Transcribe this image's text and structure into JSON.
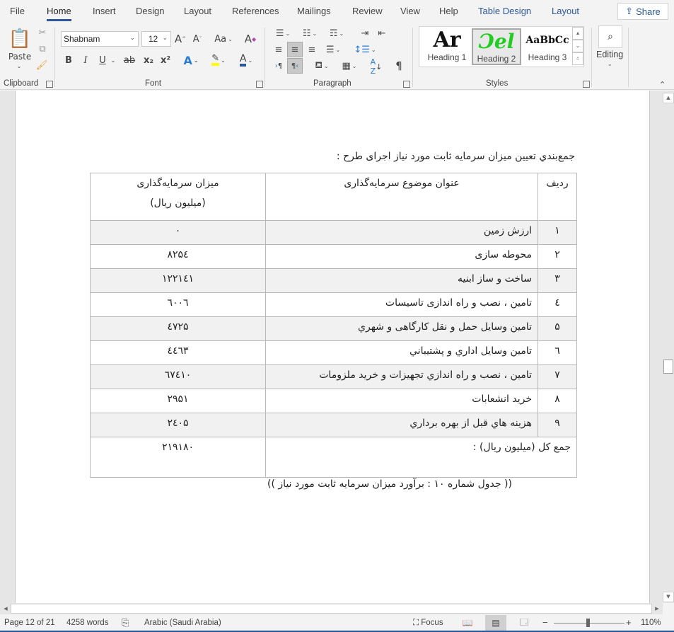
{
  "tabs": [
    {
      "label": "File"
    },
    {
      "label": "Home",
      "active": true
    },
    {
      "label": "Insert"
    },
    {
      "label": "Design"
    },
    {
      "label": "Layout"
    },
    {
      "label": "References"
    },
    {
      "label": "Mailings"
    },
    {
      "label": "Review"
    },
    {
      "label": "View"
    },
    {
      "label": "Help"
    },
    {
      "label": "Table Design",
      "contextual": true
    },
    {
      "label": "Layout",
      "contextual": true
    }
  ],
  "share_label": "Share",
  "ribbon": {
    "clipboard": {
      "label": "Clipboard",
      "paste_label": "Paste"
    },
    "font": {
      "label": "Font",
      "font_name": "Shabnam",
      "font_size": "12",
      "change_case": "Aa",
      "bold": "B",
      "italic": "I",
      "underline": "U",
      "strike": "ab",
      "subscript": "x₂",
      "superscript": "x²"
    },
    "paragraph": {
      "label": "Paragraph"
    },
    "styles": {
      "label": "Styles",
      "items": [
        {
          "preview": "Ar",
          "name": "Heading 1"
        },
        {
          "preview": "Ɔel",
          "name": "Heading 2",
          "selected": true
        },
        {
          "preview": "AaBbCc",
          "name": "Heading 3"
        }
      ]
    },
    "editing": {
      "label": "Editing"
    }
  },
  "colors": {
    "accent": "#2b579a",
    "highlight": "#ffff00",
    "font_color": "#2b579a",
    "heading2_preview": "#22cc22",
    "row_shade": "#f1f1f1"
  },
  "document": {
    "heading": "جمع‌بندي تعيين ميزان سرمايه ثابت مورد نياز اجراى طرح :",
    "table": {
      "headers": {
        "num": "رديف",
        "title": "عنوان موضوع سرمایه‌گذاری",
        "value": "ميزان سرمایه‌گذاری",
        "value_unit": "(ميليون ريال)"
      },
      "rows": [
        {
          "num": "۱",
          "title": "ارزش زمين",
          "value": "۰"
        },
        {
          "num": "۲",
          "title": "محوطه سازی",
          "value": "۸۲۵٤"
        },
        {
          "num": "۳",
          "title": "ساخت و ساز ابنيه",
          "value": "۱۲۲۱٤۱"
        },
        {
          "num": "٤",
          "title": "تامين ، نصب و راه اندازی تاسيسات",
          "value": "٦۰۰٦"
        },
        {
          "num": "۵",
          "title": "تامين وسايل حمل و نقل کارگاهی و شهري",
          "value": "٤۷۲۵"
        },
        {
          "num": "٦",
          "title": "تامين وسايل اداري و پشتيباني",
          "value": "٤٤٦۳"
        },
        {
          "num": "۷",
          "title": "تامين ، نصب و راه اندازي تجهيزات و خريد ملزومات",
          "value": "٦۷٤۱۰"
        },
        {
          "num": "۸",
          "title": "خريد انشعابات",
          "value": "۲۹۵۱"
        },
        {
          "num": "۹",
          "title": "هزينه هاي قبل از بهره برداري",
          "value": "۲٤۰۵"
        }
      ],
      "total_label": "جمع کل (ميليون ريال) :",
      "total_value": "۲۱۹۱۸۰"
    },
    "caption": "(( جدول شماره ۱۰ : برآورد ميزان سرمايه ثابت مورد نياز  ))"
  },
  "status": {
    "page": "Page 12 of 21",
    "words": "4258 words",
    "language": "Arabic (Saudi Arabia)",
    "focus": "Focus",
    "zoom": "110%",
    "zoom_minus": "−",
    "zoom_plus": "+"
  }
}
